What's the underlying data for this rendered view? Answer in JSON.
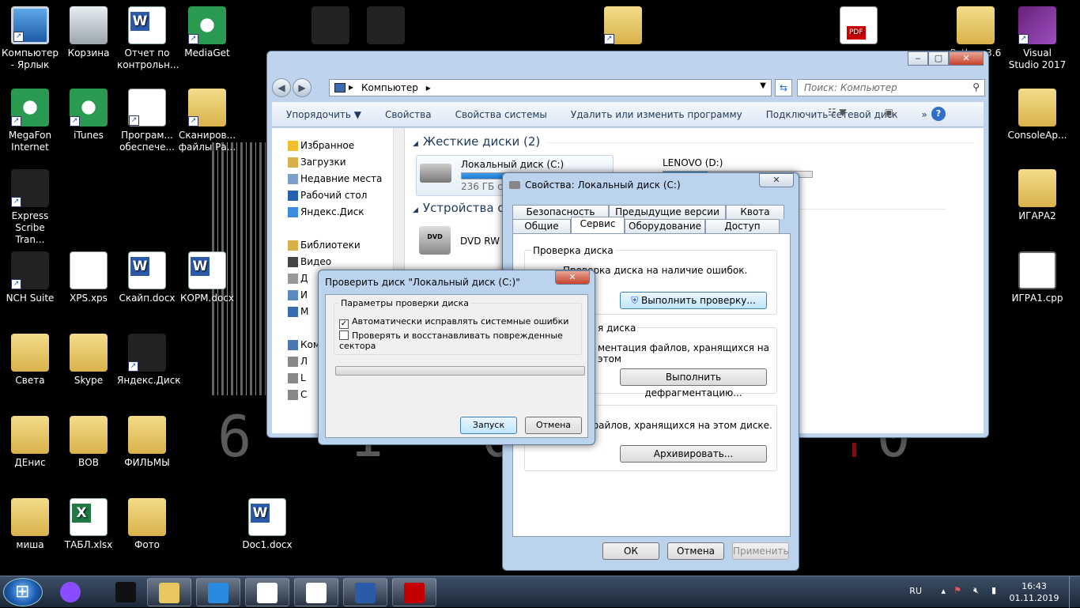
{
  "desktop_icons": [
    {
      "name": "icon-computer-shortcut",
      "label": "Компьютер - Ярлык",
      "glyph": "g-pc",
      "sc": true
    },
    {
      "name": "icon-recycle-bin",
      "label": "Корзина",
      "glyph": "g-bin",
      "sc": false
    },
    {
      "name": "icon-report",
      "label": "Отчет по контрольн...",
      "glyph": "g-word",
      "sc": false
    },
    {
      "name": "icon-mediaget",
      "label": "MediaGet",
      "glyph": "g-round",
      "sc": true
    },
    {
      "name": "icon-megafon",
      "label": "MegaFon Internet",
      "glyph": "g-round",
      "sc": true
    },
    {
      "name": "icon-itunes",
      "label": "iTunes",
      "glyph": "g-round",
      "sc": true
    },
    {
      "name": "icon-software",
      "label": "Програм... обеспече...",
      "glyph": "g-doc",
      "sc": true
    },
    {
      "name": "icon-scans",
      "label": "Сканиров... файлы Ра...",
      "glyph": "g-folder",
      "sc": true
    },
    {
      "name": "icon-express-scribe",
      "label": "Express Scribe Tran...",
      "glyph": "g-dark",
      "sc": true
    },
    {
      "name": "icon-nch-suite",
      "label": "NCH Suite",
      "glyph": "g-dark",
      "sc": true
    },
    {
      "name": "icon-xps",
      "label": "XPS.xps",
      "glyph": "g-doc",
      "sc": false
    },
    {
      "name": "icon-skain-docx",
      "label": "Скайп.docx",
      "glyph": "g-word",
      "sc": false
    },
    {
      "name": "icon-korm-docx",
      "label": "КОРМ.docx",
      "glyph": "g-word",
      "sc": false
    },
    {
      "name": "icon-sveta",
      "label": "Света",
      "glyph": "g-folder",
      "sc": false
    },
    {
      "name": "icon-skype",
      "label": "Skype",
      "glyph": "g-folder",
      "sc": false
    },
    {
      "name": "icon-yandex-disk",
      "label": "Яндекс.Диск",
      "glyph": "g-dark",
      "sc": true
    },
    {
      "name": "icon-denis",
      "label": "ДЕнис",
      "glyph": "g-folder",
      "sc": false
    },
    {
      "name": "icon-vov",
      "label": "ВОВ",
      "glyph": "g-folder",
      "sc": false
    },
    {
      "name": "icon-films",
      "label": "ФИЛЬМЫ",
      "glyph": "g-folder",
      "sc": false
    },
    {
      "name": "icon-misha",
      "label": "миша",
      "glyph": "g-folder",
      "sc": false
    },
    {
      "name": "icon-tabl-xlsx",
      "label": "ТАБЛ.xlsx",
      "glyph": "g-excel",
      "sc": false
    },
    {
      "name": "icon-foto",
      "label": "Фото",
      "glyph": "g-folder",
      "sc": false
    },
    {
      "name": "icon-doc1",
      "label": "Doc1.docx",
      "glyph": "g-word",
      "sc": false
    },
    {
      "name": "icon-pdf",
      "label": "",
      "glyph": "g-pdf",
      "sc": false
    },
    {
      "name": "icon-python",
      "label": "Python 3.6",
      "glyph": "g-folder",
      "sc": false
    },
    {
      "name": "icon-visual-studio",
      "label": "Visual Studio 2017",
      "glyph": "g-vs",
      "sc": true
    },
    {
      "name": "icon-consoleapp",
      "label": "ConsoleAp...",
      "glyph": "g-folder",
      "sc": false
    },
    {
      "name": "icon-igara2",
      "label": "ИГАРА2",
      "glyph": "g-folder",
      "sc": false
    },
    {
      "name": "icon-igra1-cpp",
      "label": "ИГРА1.cpp",
      "glyph": "g-cpp",
      "sc": false
    },
    {
      "name": "icon-idisplay",
      "label": "",
      "glyph": "g-folder",
      "sc": true
    },
    {
      "name": "icon-photo1",
      "label": "",
      "glyph": "g-dark",
      "sc": false
    },
    {
      "name": "icon-photo2",
      "label": "",
      "glyph": "g-dark",
      "sc": false
    }
  ],
  "explorer": {
    "address": "Компьютер",
    "search_placeholder": "Поиск: Компьютер",
    "toolbar": [
      "Упорядочить ▼",
      "Свойства",
      "Свойства системы",
      "Удалить или изменить программу",
      "Подключить сетевой диск",
      "»"
    ],
    "nav": [
      {
        "label": "Избранное",
        "icon": "star-icon",
        "color": "#f0c030"
      },
      {
        "label": "Загрузки",
        "icon": "downloads-icon",
        "color": "#d8b048"
      },
      {
        "label": "Недавние места",
        "icon": "recent-places-icon",
        "color": "#7aa0c8"
      },
      {
        "label": "Рабочий стол",
        "icon": "desktop-icon",
        "color": "#2860b0"
      },
      {
        "label": "Яндекс.Диск",
        "icon": "yandex-disk-icon",
        "color": "#3b8de0"
      },
      {
        "label": "",
        "icon": "",
        "color": ""
      },
      {
        "label": "Библиотеки",
        "icon": "libraries-icon",
        "color": "#d8b048"
      },
      {
        "label": "Видео",
        "icon": "video-icon",
        "color": "#444"
      },
      {
        "label": "Д",
        "icon": "documents-icon",
        "color": "#999"
      },
      {
        "label": "И",
        "icon": "images-icon",
        "color": "#5a8ac0"
      },
      {
        "label": "М",
        "icon": "music-icon",
        "color": "#3a6ab0"
      },
      {
        "label": "",
        "icon": "",
        "color": ""
      },
      {
        "label": "Ком",
        "icon": "computer-icon",
        "color": "#4a78b0"
      },
      {
        "label": "Л",
        "icon": "drive-icon",
        "color": "#888"
      },
      {
        "label": "L",
        "icon": "drive-icon",
        "color": "#888"
      },
      {
        "label": "С",
        "icon": "drive-icon",
        "color": "#888"
      }
    ],
    "group_hdd": "Жесткие диски (2)",
    "drive_c": {
      "label": "Локальный диск (C:)",
      "free": "236 ГБ св",
      "fill": 0.45
    },
    "drive_d": {
      "label": "LENOVO (D:)",
      "fill": 0.3
    },
    "group_removable": "Устройства со",
    "dvd": {
      "label": "DVD RW д",
      "badge": "DVD"
    }
  },
  "props": {
    "title": "Свойства: Локальный диск (C:)",
    "tabs_top": [
      "Безопасность",
      "Предыдущие версии",
      "Квота"
    ],
    "tabs_bottom": [
      "Общие",
      "Сервис",
      "Оборудование",
      "Доступ"
    ],
    "g1_label": "Проверка диска",
    "g1_text": "Проверка диска на наличие ошибок.",
    "g1_btn": "Выполнить проверку...",
    "g2_label": "я диска",
    "g2_text": "ментация файлов, хранящихся на этом",
    "g2_btn": "Выполнить дефрагментацию...",
    "g3_text": "ия файлов, хранящихся на этом диске.",
    "g3_btn": "Архивировать...",
    "ok": "ОК",
    "cancel": "Отмена",
    "apply": "Применить"
  },
  "check": {
    "title": "Проверить диск \"Локальный диск (C:)\"",
    "group": "Параметры проверки диска",
    "opt1": "Автоматически исправлять системные ошибки",
    "opt1_checked": true,
    "opt2": "Проверять и восстанавливать поврежденные сектора",
    "opt2_checked": false,
    "start": "Запуск",
    "cancel": "Отмена"
  },
  "taskbar": {
    "lang": "RU",
    "time": "16:43",
    "date": "01.11.2019",
    "apps": [
      {
        "name": "taskbar-alice",
        "color": "#8a4cff"
      },
      {
        "name": "taskbar-cmd",
        "color": "#111"
      },
      {
        "name": "taskbar-explorer",
        "color": "#e8c660"
      },
      {
        "name": "taskbar-ie",
        "color": "#2a8ae0"
      },
      {
        "name": "taskbar-yandex-browser",
        "color": "#fff"
      },
      {
        "name": "taskbar-yandex",
        "color": "#fff"
      },
      {
        "name": "taskbar-word",
        "color": "#2b5aa8"
      },
      {
        "name": "taskbar-acrobat",
        "color": "#c40000"
      }
    ]
  },
  "bg_digits": "6 1 0 0 0 0"
}
